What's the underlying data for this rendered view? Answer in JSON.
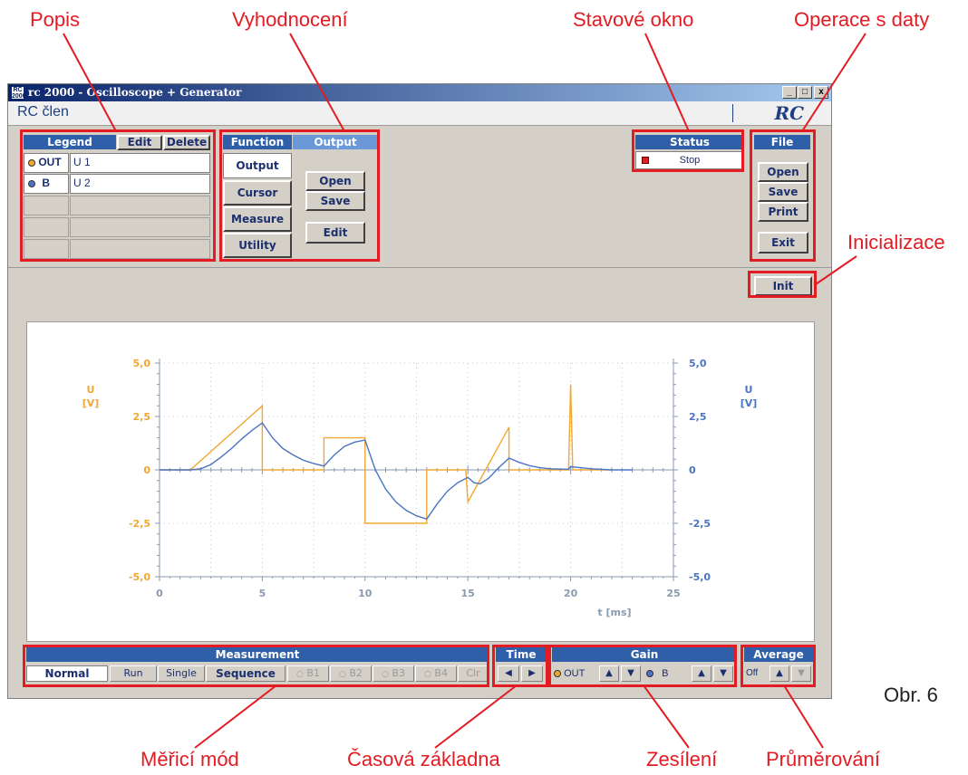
{
  "annotations": {
    "popis": "Popis",
    "vyhodnoceni": "Vyhodnocení",
    "stavove_okno": "Stavové okno",
    "operace_s_daty": "Operace s daty",
    "inicializace": "Inicializace",
    "merici_mod": "Měřicí mód",
    "casova_zakladna": "Časová základna",
    "zesileni": "Zesílení",
    "prumerovani": "Průměrování",
    "figure_label": "Obr. 6"
  },
  "window": {
    "icon_text": "RC 2000",
    "title": "rc 2000 - Oscilloscope + Generator",
    "min": "_",
    "max": "□",
    "close": "x",
    "doc_name": "RC člen",
    "brand": "RC"
  },
  "legend": {
    "title": "Legend",
    "edit": "Edit",
    "delete": "Delete",
    "rows": [
      {
        "channel": "OUT",
        "label": "U 1",
        "color": "#f0a830"
      },
      {
        "channel": "B",
        "label": "U 2",
        "color": "#4a74c4"
      }
    ]
  },
  "function": {
    "title": "Function",
    "tabs": [
      "Output",
      "Cursor",
      "Measure",
      "Utility"
    ],
    "active": "Output"
  },
  "output": {
    "title": "Output",
    "open": "Open",
    "save": "Save",
    "edit": "Edit"
  },
  "status": {
    "title": "Status",
    "value": "Stop",
    "indicator_color": "#e02020"
  },
  "file": {
    "title": "File",
    "open": "Open",
    "save": "Save",
    "print": "Print",
    "exit": "Exit"
  },
  "init": {
    "label": "Init"
  },
  "measurement": {
    "title": "Measurement",
    "buttons": [
      "Normal",
      "Run",
      "Single",
      "Sequence"
    ],
    "active": "Normal",
    "bufs": [
      "B1",
      "B2",
      "B3",
      "B4"
    ],
    "clr": "Clr"
  },
  "time": {
    "title": "Time",
    "left": "◀",
    "right": "▶"
  },
  "gain": {
    "title": "Gain",
    "ch1": "OUT",
    "ch2": "B",
    "up": "▲",
    "down": "▼"
  },
  "average": {
    "title": "Average",
    "value": "Off",
    "up": "▲",
    "down": "▼"
  },
  "colors": {
    "out": "#f0a830",
    "b": "#4a74c4",
    "accent": "#2e5fa8",
    "annotation": "#e31b23"
  },
  "chart_data": {
    "type": "line",
    "xlabel": "t [ms]",
    "ylabel_left": [
      "U",
      "[V]"
    ],
    "ylabel_right": [
      "U",
      "[V]"
    ],
    "xlim": [
      0,
      25
    ],
    "ylim": [
      -5,
      5
    ],
    "x_ticks": [
      0,
      5,
      10,
      15,
      20,
      25
    ],
    "y_ticks": [
      5,
      2.5,
      0,
      -2.5,
      -5
    ],
    "y_tick_labels": [
      "5,0",
      "2,5",
      "0",
      "-2,5",
      "-5,0"
    ],
    "grid": true,
    "series": [
      {
        "name": "OUT",
        "color": "#f0a830",
        "points": [
          [
            0,
            0
          ],
          [
            1.5,
            0
          ],
          [
            5,
            3
          ],
          [
            5,
            0
          ],
          [
            8,
            0
          ],
          [
            8,
            1.5
          ],
          [
            10,
            1.5
          ],
          [
            10,
            -2.5
          ],
          [
            13,
            -2.5
          ],
          [
            13,
            0
          ],
          [
            14.9,
            0
          ],
          [
            15,
            -1.5
          ],
          [
            17,
            2
          ],
          [
            17,
            0
          ],
          [
            19.9,
            0
          ],
          [
            20,
            4
          ],
          [
            20.1,
            0
          ],
          [
            22,
            0
          ]
        ]
      },
      {
        "name": "B",
        "color": "#4a74c4",
        "points": [
          [
            0,
            0
          ],
          [
            1.5,
            0
          ],
          [
            2,
            0.05
          ],
          [
            2.5,
            0.25
          ],
          [
            3,
            0.6
          ],
          [
            3.5,
            1.0
          ],
          [
            4,
            1.45
          ],
          [
            4.5,
            1.85
          ],
          [
            5,
            2.2
          ],
          [
            5.5,
            1.5
          ],
          [
            6,
            1.0
          ],
          [
            6.5,
            0.7
          ],
          [
            7,
            0.45
          ],
          [
            7.5,
            0.3
          ],
          [
            8,
            0.18
          ],
          [
            8.5,
            0.7
          ],
          [
            9,
            1.1
          ],
          [
            9.5,
            1.3
          ],
          [
            10,
            1.4
          ],
          [
            10.5,
            0.0
          ],
          [
            11,
            -0.9
          ],
          [
            11.5,
            -1.5
          ],
          [
            12,
            -1.9
          ],
          [
            12.5,
            -2.15
          ],
          [
            13,
            -2.3
          ],
          [
            13.5,
            -1.6
          ],
          [
            14,
            -1.0
          ],
          [
            14.5,
            -0.6
          ],
          [
            15,
            -0.35
          ],
          [
            15.3,
            -0.6
          ],
          [
            15.6,
            -0.65
          ],
          [
            16,
            -0.4
          ],
          [
            16.5,
            0.1
          ],
          [
            17,
            0.55
          ],
          [
            17.5,
            0.35
          ],
          [
            18,
            0.2
          ],
          [
            18.5,
            0.1
          ],
          [
            19,
            0.05
          ],
          [
            19.9,
            0.03
          ],
          [
            20,
            0.15
          ],
          [
            20.5,
            0.1
          ],
          [
            21,
            0.05
          ],
          [
            22,
            0.0
          ],
          [
            23,
            0
          ]
        ]
      }
    ]
  }
}
